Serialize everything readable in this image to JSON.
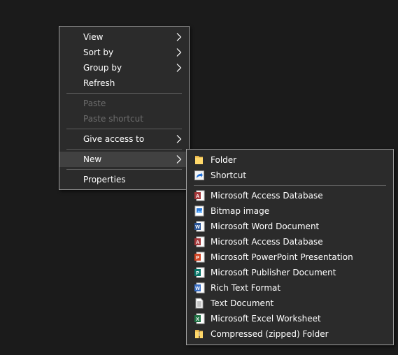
{
  "context_menu": {
    "items": [
      {
        "label": "View",
        "has_submenu": true
      },
      {
        "label": "Sort by",
        "has_submenu": true
      },
      {
        "label": "Group by",
        "has_submenu": true
      },
      {
        "label": "Refresh"
      },
      {
        "label": "Paste",
        "disabled": true
      },
      {
        "label": "Paste shortcut",
        "disabled": true
      },
      {
        "label": "Give access to",
        "has_submenu": true
      },
      {
        "label": "New",
        "has_submenu": true,
        "highlighted": true
      },
      {
        "label": "Properties"
      }
    ]
  },
  "new_submenu": {
    "items": [
      {
        "label": "Folder",
        "icon": "folder-icon"
      },
      {
        "label": "Shortcut",
        "icon": "shortcut-icon"
      },
      {
        "label": "Microsoft Access Database",
        "icon": "access-icon"
      },
      {
        "label": "Bitmap image",
        "icon": "bitmap-icon"
      },
      {
        "label": "Microsoft Word Document",
        "icon": "word-icon"
      },
      {
        "label": "Microsoft Access Database",
        "icon": "access-icon"
      },
      {
        "label": "Microsoft PowerPoint Presentation",
        "icon": "powerpoint-icon"
      },
      {
        "label": "Microsoft Publisher Document",
        "icon": "publisher-icon"
      },
      {
        "label": "Rich Text Format",
        "icon": "wordpad-icon"
      },
      {
        "label": "Text Document",
        "icon": "text-document-icon"
      },
      {
        "label": "Microsoft Excel Worksheet",
        "icon": "excel-icon"
      },
      {
        "label": "Compressed (zipped) Folder",
        "icon": "zip-folder-icon"
      }
    ]
  },
  "colors": {
    "background": "#1b1b1b",
    "menu_background": "#2b2b2b",
    "menu_border": "#a0a0a0",
    "highlight": "#414141",
    "text": "#ffffff",
    "disabled_text": "#6d6d6d",
    "separator": "#5c5c5c"
  }
}
